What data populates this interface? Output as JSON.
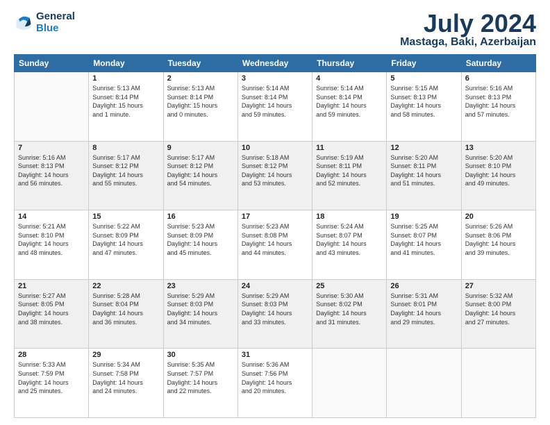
{
  "header": {
    "logo_general": "General",
    "logo_blue": "Blue",
    "month_title": "July 2024",
    "location": "Mastaga, Baki, Azerbaijan"
  },
  "days_of_week": [
    "Sunday",
    "Monday",
    "Tuesday",
    "Wednesday",
    "Thursday",
    "Friday",
    "Saturday"
  ],
  "weeks": [
    [
      {
        "day": "",
        "info": ""
      },
      {
        "day": "1",
        "info": "Sunrise: 5:13 AM\nSunset: 8:14 PM\nDaylight: 15 hours\nand 1 minute."
      },
      {
        "day": "2",
        "info": "Sunrise: 5:13 AM\nSunset: 8:14 PM\nDaylight: 15 hours\nand 0 minutes."
      },
      {
        "day": "3",
        "info": "Sunrise: 5:14 AM\nSunset: 8:14 PM\nDaylight: 14 hours\nand 59 minutes."
      },
      {
        "day": "4",
        "info": "Sunrise: 5:14 AM\nSunset: 8:14 PM\nDaylight: 14 hours\nand 59 minutes."
      },
      {
        "day": "5",
        "info": "Sunrise: 5:15 AM\nSunset: 8:13 PM\nDaylight: 14 hours\nand 58 minutes."
      },
      {
        "day": "6",
        "info": "Sunrise: 5:16 AM\nSunset: 8:13 PM\nDaylight: 14 hours\nand 57 minutes."
      }
    ],
    [
      {
        "day": "7",
        "info": "Sunrise: 5:16 AM\nSunset: 8:13 PM\nDaylight: 14 hours\nand 56 minutes."
      },
      {
        "day": "8",
        "info": "Sunrise: 5:17 AM\nSunset: 8:12 PM\nDaylight: 14 hours\nand 55 minutes."
      },
      {
        "day": "9",
        "info": "Sunrise: 5:17 AM\nSunset: 8:12 PM\nDaylight: 14 hours\nand 54 minutes."
      },
      {
        "day": "10",
        "info": "Sunrise: 5:18 AM\nSunset: 8:12 PM\nDaylight: 14 hours\nand 53 minutes."
      },
      {
        "day": "11",
        "info": "Sunrise: 5:19 AM\nSunset: 8:11 PM\nDaylight: 14 hours\nand 52 minutes."
      },
      {
        "day": "12",
        "info": "Sunrise: 5:20 AM\nSunset: 8:11 PM\nDaylight: 14 hours\nand 51 minutes."
      },
      {
        "day": "13",
        "info": "Sunrise: 5:20 AM\nSunset: 8:10 PM\nDaylight: 14 hours\nand 49 minutes."
      }
    ],
    [
      {
        "day": "14",
        "info": "Sunrise: 5:21 AM\nSunset: 8:10 PM\nDaylight: 14 hours\nand 48 minutes."
      },
      {
        "day": "15",
        "info": "Sunrise: 5:22 AM\nSunset: 8:09 PM\nDaylight: 14 hours\nand 47 minutes."
      },
      {
        "day": "16",
        "info": "Sunrise: 5:23 AM\nSunset: 8:09 PM\nDaylight: 14 hours\nand 45 minutes."
      },
      {
        "day": "17",
        "info": "Sunrise: 5:23 AM\nSunset: 8:08 PM\nDaylight: 14 hours\nand 44 minutes."
      },
      {
        "day": "18",
        "info": "Sunrise: 5:24 AM\nSunset: 8:07 PM\nDaylight: 14 hours\nand 43 minutes."
      },
      {
        "day": "19",
        "info": "Sunrise: 5:25 AM\nSunset: 8:07 PM\nDaylight: 14 hours\nand 41 minutes."
      },
      {
        "day": "20",
        "info": "Sunrise: 5:26 AM\nSunset: 8:06 PM\nDaylight: 14 hours\nand 39 minutes."
      }
    ],
    [
      {
        "day": "21",
        "info": "Sunrise: 5:27 AM\nSunset: 8:05 PM\nDaylight: 14 hours\nand 38 minutes."
      },
      {
        "day": "22",
        "info": "Sunrise: 5:28 AM\nSunset: 8:04 PM\nDaylight: 14 hours\nand 36 minutes."
      },
      {
        "day": "23",
        "info": "Sunrise: 5:29 AM\nSunset: 8:03 PM\nDaylight: 14 hours\nand 34 minutes."
      },
      {
        "day": "24",
        "info": "Sunrise: 5:29 AM\nSunset: 8:03 PM\nDaylight: 14 hours\nand 33 minutes."
      },
      {
        "day": "25",
        "info": "Sunrise: 5:30 AM\nSunset: 8:02 PM\nDaylight: 14 hours\nand 31 minutes."
      },
      {
        "day": "26",
        "info": "Sunrise: 5:31 AM\nSunset: 8:01 PM\nDaylight: 14 hours\nand 29 minutes."
      },
      {
        "day": "27",
        "info": "Sunrise: 5:32 AM\nSunset: 8:00 PM\nDaylight: 14 hours\nand 27 minutes."
      }
    ],
    [
      {
        "day": "28",
        "info": "Sunrise: 5:33 AM\nSunset: 7:59 PM\nDaylight: 14 hours\nand 25 minutes."
      },
      {
        "day": "29",
        "info": "Sunrise: 5:34 AM\nSunset: 7:58 PM\nDaylight: 14 hours\nand 24 minutes."
      },
      {
        "day": "30",
        "info": "Sunrise: 5:35 AM\nSunset: 7:57 PM\nDaylight: 14 hours\nand 22 minutes."
      },
      {
        "day": "31",
        "info": "Sunrise: 5:36 AM\nSunset: 7:56 PM\nDaylight: 14 hours\nand 20 minutes."
      },
      {
        "day": "",
        "info": ""
      },
      {
        "day": "",
        "info": ""
      },
      {
        "day": "",
        "info": ""
      }
    ]
  ]
}
